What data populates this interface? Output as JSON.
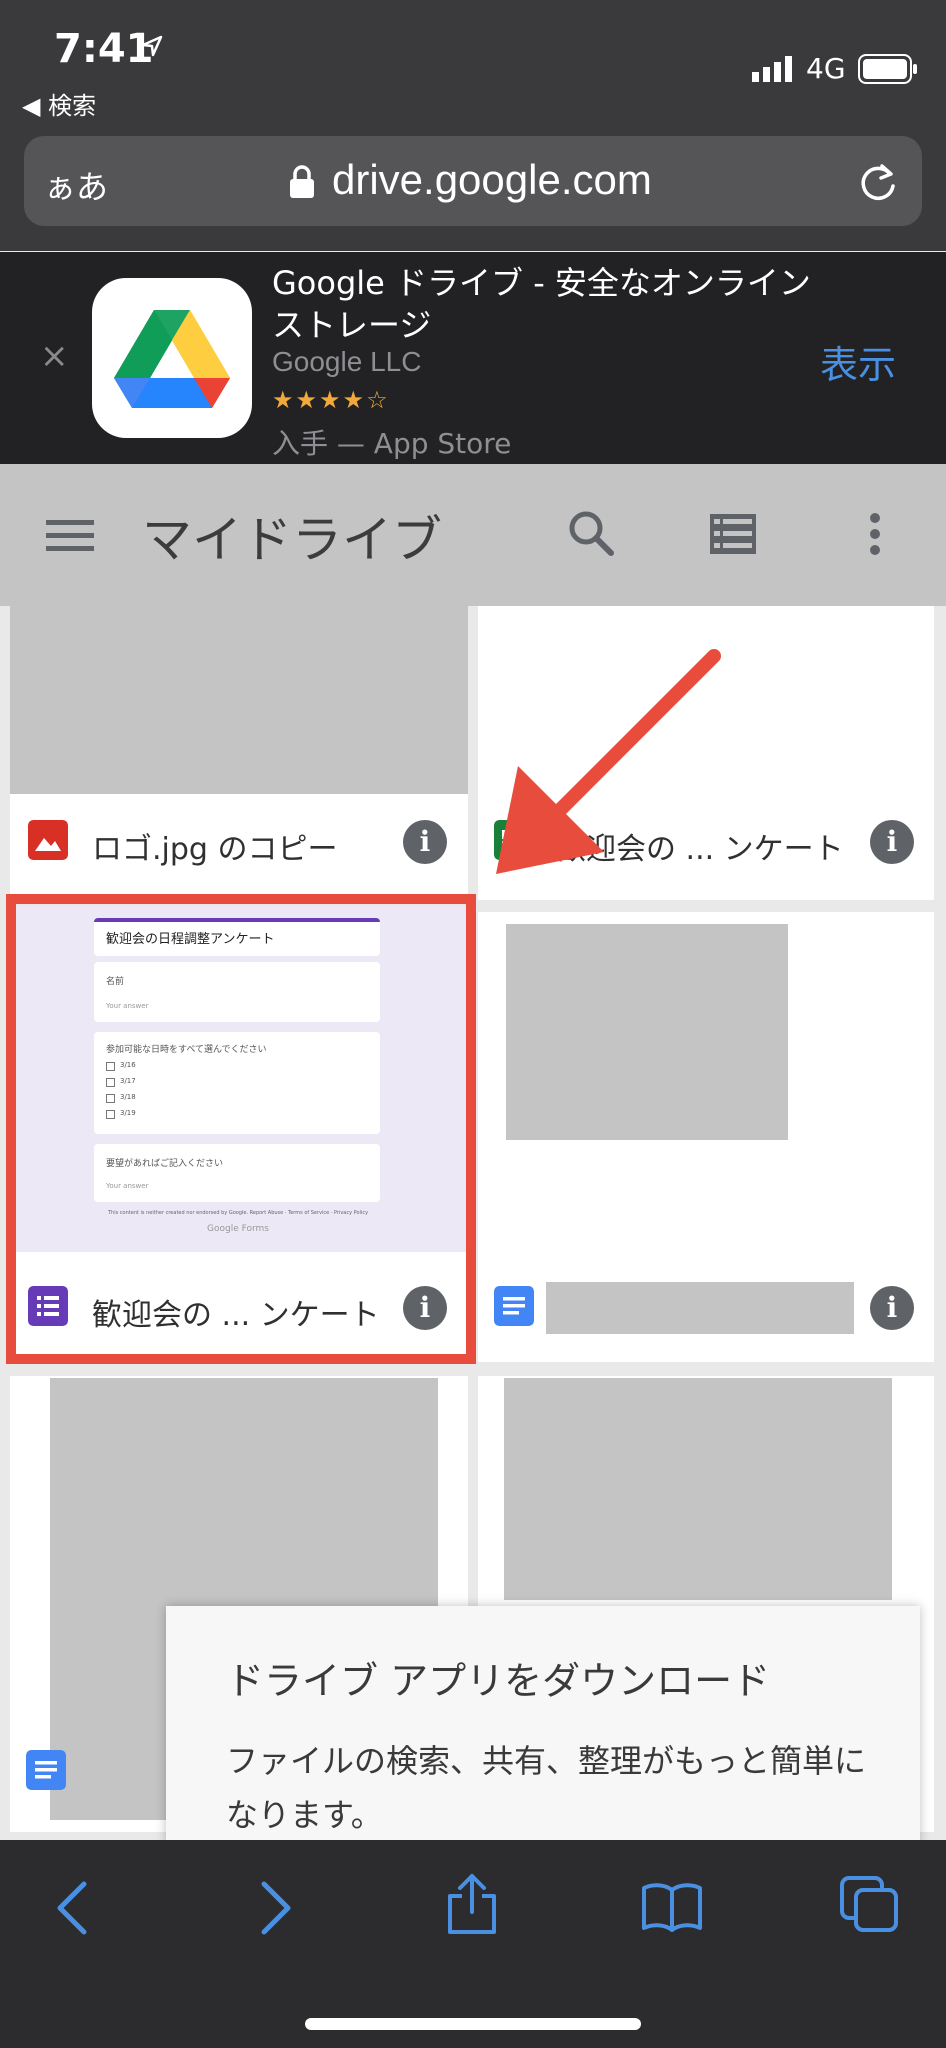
{
  "status_bar": {
    "time": "7:41",
    "back_label": "◀ 検索",
    "network": "4G"
  },
  "browser": {
    "aa_label": "ぁあ",
    "url": "drive.google.com"
  },
  "app_banner": {
    "title": "Google ドライブ - 安全なオンライン ストレージ",
    "developer": "Google LLC",
    "rating_stars": "★★★★☆",
    "rating": 4.5,
    "store_label": "入手 — App Store",
    "view_label": "表示",
    "close_label": "×"
  },
  "drive_header": {
    "title": "マイドライブ"
  },
  "files": [
    {
      "name": "ロゴ.jpg のコピー",
      "type": "image",
      "icon_color": "#d93025"
    },
    {
      "name": "歓迎会の ... ンケート",
      "type": "sheets",
      "icon_color": "#188038"
    },
    {
      "name": "歓迎会の ... ンケート",
      "type": "forms",
      "icon_color": "#673ab7"
    },
    {
      "name": "",
      "type": "docs",
      "icon_color": "#4285f4"
    }
  ],
  "info_label": "i",
  "form_preview": {
    "title": "歓迎会の日程調整アンケート",
    "q1": "名前",
    "q1_placeholder": "Your answer",
    "q2": "参加可能な日時をすべて選んでください",
    "options": [
      "3/16",
      "3/17",
      "3/18",
      "3/19"
    ],
    "q3": "要望があればご記入ください",
    "q3_placeholder": "Your answer",
    "footer": "This content is neither created nor endorsed by Google. Report Abuse · Terms of Service · Privacy Policy",
    "brand": "Google Forms"
  },
  "download_popup": {
    "title": "ドライブ アプリをダウンロード",
    "body": "ファイルの検索、共有、整理がもっと簡単になります。"
  },
  "colors": {
    "highlight": "#e84c3d",
    "annotation_arrow": "#e84c3d",
    "link_blue": "#4a90e2"
  }
}
